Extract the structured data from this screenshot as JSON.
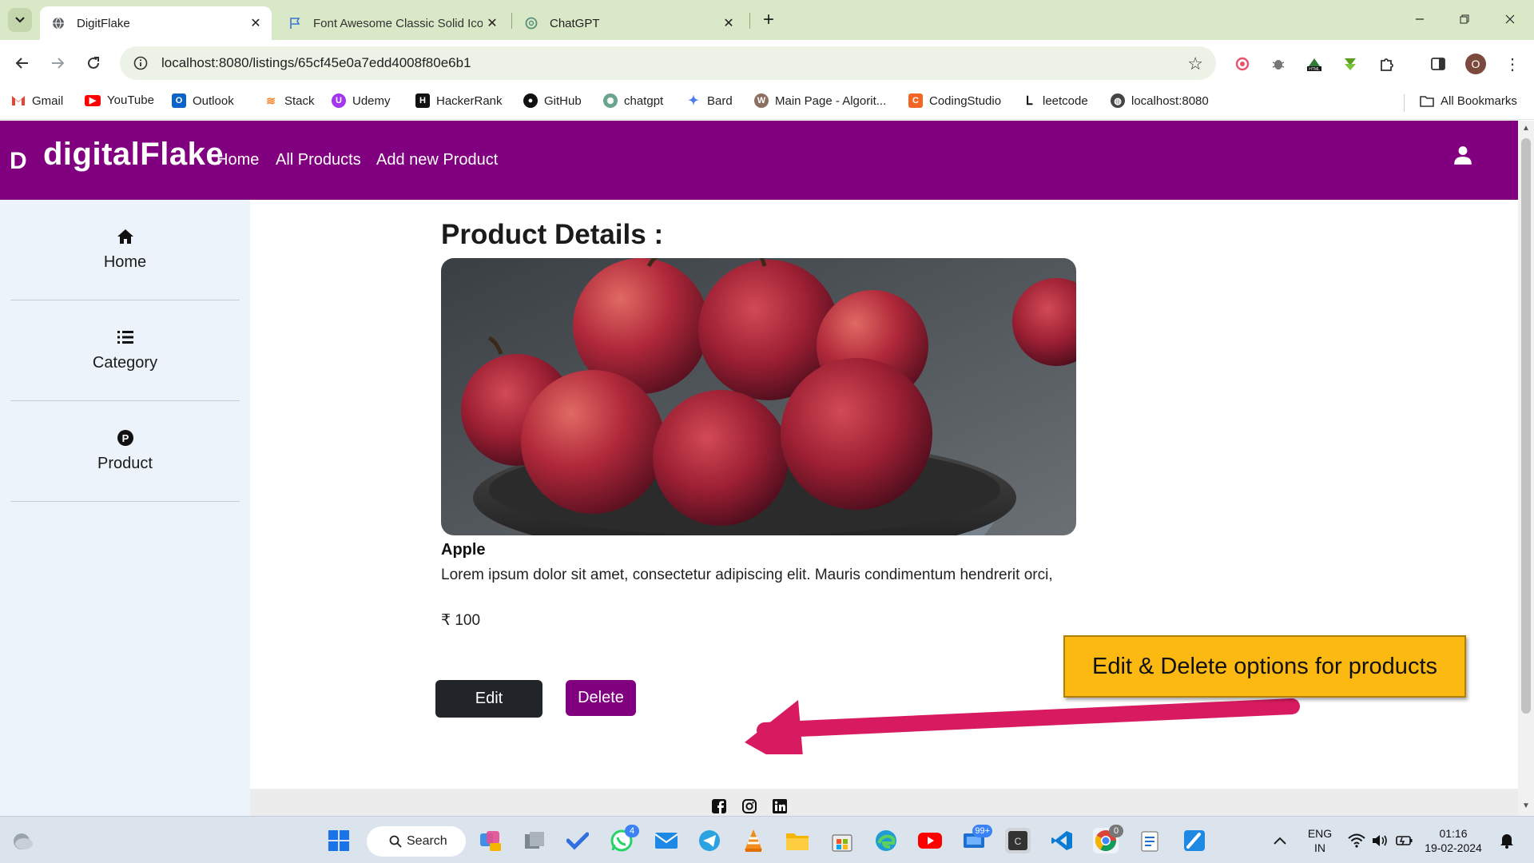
{
  "browser": {
    "tabs": [
      {
        "title": "DigitFlake",
        "active": true
      },
      {
        "title": "Font Awesome Classic Solid Icons",
        "active": false
      },
      {
        "title": "ChatGPT",
        "active": false
      }
    ],
    "url": "localhost:8080/listings/65cf45e0a7edd4008f80e6b1",
    "bookmarks": [
      "Gmail",
      "YouTube",
      "Outlook",
      "Stack",
      "Udemy",
      "HackerRank",
      "GitHub",
      "chatgpt",
      "Bard",
      "Main Page - Algorit...",
      "CodingStudio",
      "leetcode",
      "localhost:8080"
    ],
    "all_bookmarks": "All Bookmarks",
    "profile_initial": "O"
  },
  "navbar": {
    "logo_letter": "D",
    "brand": "digitalFlake",
    "links": [
      "Home",
      "All Products",
      "Add new Product"
    ]
  },
  "sidebar": {
    "items": [
      {
        "label": "Home",
        "icon": "house-icon"
      },
      {
        "label": "Category",
        "icon": "list-icon"
      },
      {
        "label": "Product",
        "icon": "product-p-icon"
      }
    ]
  },
  "product": {
    "heading": "Product Details :",
    "name": "Apple",
    "description": "Lorem ipsum dolor sit amet, consectetur adipiscing elit. Mauris condimentum hendrerit orci,",
    "price": "₹ 100",
    "edit_label": "Edit",
    "delete_label": "Delete"
  },
  "annotation": {
    "text": "Edit & Delete options for products",
    "color": "#fbb912",
    "arrow_color": "#d81b60"
  },
  "footer": {
    "icons": [
      "facebook-icon",
      "instagram-icon",
      "linkedin-icon"
    ]
  },
  "taskbar": {
    "search_label": "Search",
    "whatsapp_badge": "4",
    "store_badge": "99+",
    "chrome_badge": "0",
    "lang": "ENG",
    "region": "IN",
    "time": "01:16",
    "date": "19-02-2024"
  },
  "colors": {
    "brand_purple": "#800080",
    "sidebar_bg": "#edf3fa",
    "edit_dark": "#212529"
  }
}
